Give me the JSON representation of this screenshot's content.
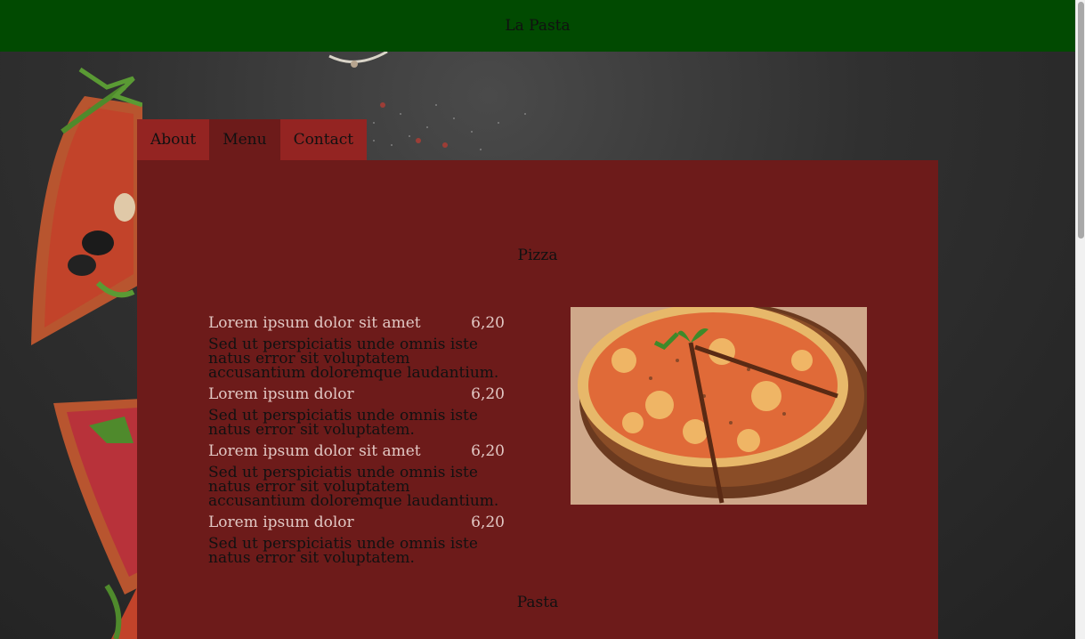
{
  "header": {
    "title": "La Pasta"
  },
  "tabs": [
    {
      "label": "About",
      "active": false
    },
    {
      "label": "Menu",
      "active": true
    },
    {
      "label": "Contact",
      "active": false
    }
  ],
  "sections": [
    {
      "title": "Pizza",
      "items": [
        {
          "name": "Lorem ipsum dolor sit amet",
          "price": "6,20",
          "description": "Sed ut perspiciatis unde omnis iste natus error sit voluptatem accusantium doloremque laudantium."
        },
        {
          "name": "Lorem ipsum dolor",
          "price": "6,20",
          "description": "Sed ut perspiciatis unde omnis iste natus error sit voluptatem."
        },
        {
          "name": "Lorem ipsum dolor sit amet",
          "price": "6,20",
          "description": "Sed ut perspiciatis unde omnis iste natus error sit voluptatem accusantium doloremque laudantium."
        },
        {
          "name": "Lorem ipsum dolor",
          "price": "6,20",
          "description": "Sed ut perspiciatis unde omnis iste natus error sit voluptatem."
        }
      ]
    },
    {
      "title": "Pasta"
    }
  ],
  "colors": {
    "header": "#014a01",
    "tab": "#942422",
    "tab_active": "#6d1b1a",
    "panel": "#6d1b1a",
    "item_name": "#e2c8c4"
  }
}
